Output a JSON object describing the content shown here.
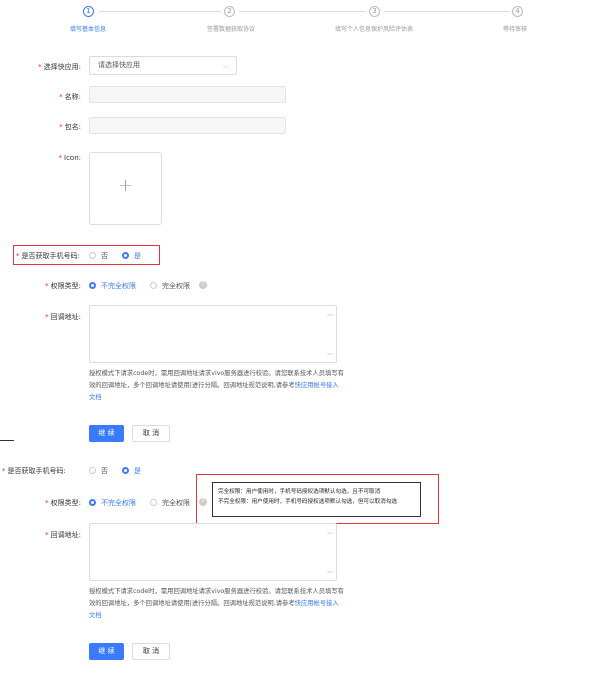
{
  "steps": [
    {
      "num": "1",
      "label": "填写基本信息",
      "active": true
    },
    {
      "num": "2",
      "label": "签署数据获取协议",
      "active": false
    },
    {
      "num": "3",
      "label": "填写个人信息保护风险评估表",
      "active": false
    },
    {
      "num": "4",
      "label": "等待审核",
      "active": false
    }
  ],
  "form": {
    "quickapp_label": "选择快应用:",
    "quickapp_placeholder": "请选择快应用",
    "name_label": "名称:",
    "package_label": "包名:",
    "icon_label": "Icon:",
    "upload_plus": "+",
    "get_phone_label": "是否获取手机号码:",
    "opt_no": "否",
    "opt_yes": "是",
    "perm_label": "权限类型:",
    "perm_partial": "不完全权限",
    "perm_full": "完全权限",
    "help_glyph": "?",
    "callback_label": "回调地址:",
    "hint_text": "授权模式下请求code时，需用回调地址请求vivo服务器进行校验。请您联系技术人员填写有效的回调地址，多个回调地址请使用|进行分隔。回调地址规范说明,请参考",
    "hint_link": "快应用帐号接入文档",
    "continue_btn": "继 续",
    "cancel_btn": "取 消"
  },
  "tooltip": {
    "line1": "完全权限：用户使用时，手机号码授权选项默认勾选，且不可取消",
    "line2": "不完全权限：用户使用时，手机号码授权选项默认勾选，但可以取消勾选"
  },
  "colors": {
    "primary": "#3a7afe",
    "required": "#f5222d",
    "highlight": "#e0383e"
  }
}
